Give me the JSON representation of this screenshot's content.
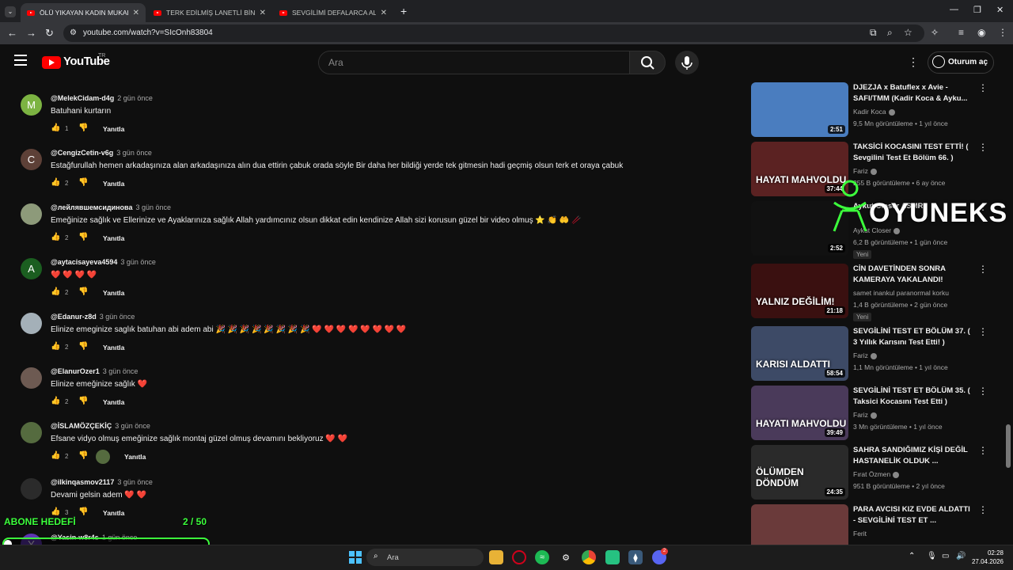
{
  "browser": {
    "tabs": [
      {
        "title": "ÖLÜ YIKAYAN KADIN MUKADDES",
        "active": true
      },
      {
        "title": "TERK EDİLMİŞ LANETLİ BİNAYA",
        "active": false
      },
      {
        "title": "SEVGİLİMİ DEFALARCA ALDATTI",
        "active": false
      }
    ],
    "new_tab": "+",
    "url": "youtube.com/watch?v=SIcOnh83804"
  },
  "header": {
    "logo_text": "YouTube",
    "region": "TR",
    "search_placeholder": "Ara",
    "signin_label": "Oturum aç"
  },
  "comments": [
    {
      "author": "@MelekCidam-d4g",
      "time": "2 gün önce",
      "text": "Batuhani kurtarın",
      "likes": "1",
      "reply": "Yanıtla",
      "avatar_letter": "M",
      "avatar_color": "#7cb342"
    },
    {
      "author": "@CengizCetin-v6g",
      "time": "3 gün önce",
      "text": "Estağfurullah hemen arkadaşınıza alan arkadaşınıza alın dua ettirin çabuk orada söyle Bir daha her bildiği yerde tek gitmesin hadi geçmiş olsun terk et oraya çabuk",
      "likes": "2",
      "reply": "Yanıtla",
      "avatar_letter": "C",
      "avatar_color": "#5d4037"
    },
    {
      "author": "@лейлявшемсидинова",
      "time": "3 gün önce",
      "text": "Emeğinize sağlık ve Ellerinize ve Ayaklarınıza sağlık Allah yardımcınız olsun dikkat edin kendinize Allah sizi korusun güzel bir video olmuş ⭐ 👏 🤲 🥢",
      "likes": "2",
      "reply": "Yanıtla",
      "avatar_letter": "",
      "avatar_color": "#8d9a7a"
    },
    {
      "author": "@aytacisayeva4594",
      "time": "3 gün önce",
      "text": "❤️ ❤️ ❤️ ❤️",
      "likes": "2",
      "reply": "Yanıtla",
      "avatar_letter": "A",
      "avatar_color": "#1b5e20"
    },
    {
      "author": "@Edanur-z8d",
      "time": "3 gün önce",
      "text": "Elinize emeginize saglık batuhan abi adem abi 🎉 🎉 🎉 🎉 🎉 🎉 🎉 🎉 ❤️ ❤️ ❤️ ❤️ ❤️ ❤️ ❤️ ❤️",
      "likes": "2",
      "reply": "Yanıtla",
      "avatar_letter": "",
      "avatar_color": "#a4b0b8"
    },
    {
      "author": "@ElanurOzer1",
      "time": "3 gün önce",
      "text": "Elinize emeğinize sağlık ❤️",
      "likes": "2",
      "reply": "Yanıtla",
      "avatar_letter": "",
      "avatar_color": "#6d5a52"
    },
    {
      "author": "@İSLAMÖZÇEKİÇ",
      "time": "3 gün önce",
      "text": "Efsane vidyo olmuş emeğinize sağlık montaj güzel olmuş devamını bekliyoruz ❤️ ❤️",
      "likes": "2",
      "reply": "Yanıtla",
      "avatar_letter": "",
      "avatar_color": "#556b3f"
    },
    {
      "author": "@ilkinqasmov2117",
      "time": "3 gün önce",
      "text": "Devami gelsin adem ❤️ ❤️",
      "likes": "3",
      "reply": "Yanıtla",
      "avatar_letter": "",
      "avatar_color": "#2b2b2b"
    },
    {
      "author": "@Yasin-w8r4s",
      "time": "1 gün önce",
      "text": "",
      "likes": "",
      "reply": "",
      "avatar_letter": "Y",
      "avatar_color": "#5e35b1"
    }
  ],
  "videos": [
    {
      "title": "DJEZJA x Batuflex x Avie - SAFI/TMM (Kadir Koca & Ayku...",
      "channel": "Kadir Koca",
      "meta": "9,5 Mn görüntüleme • 1 yıl önce",
      "duration": "2:51",
      "badge": "",
      "thumb_text": "",
      "thumb_color": "#4a7dbf"
    },
    {
      "title": "TAKSİCİ KOCASINI TEST ETTİ! ( Sevgilini Test Et Bölüm 66. )",
      "channel": "Fariz",
      "meta": "255 B görüntüleme • 6 ay önce",
      "duration": "37:44",
      "badge": "",
      "thumb_text": "HAYATI MAHVOLDU",
      "thumb_color": "#5b2222"
    },
    {
      "title": "Aykut Closer ASMR",
      "channel": "Aykut Closer",
      "meta": "6,2 B görüntüleme • 1 gün önce",
      "duration": "2:52",
      "badge": "Yeni",
      "thumb_text": "",
      "thumb_color": "#111111"
    },
    {
      "title": "CİN DAVETİNDEN SONRA KAMERAYA YAKALANDI!",
      "channel": "samet inankul paranormal korku",
      "meta": "1,4 B görüntüleme • 2 gün önce",
      "duration": "21:18",
      "badge": "Yeni",
      "thumb_text": "YALNIZ DEĞİLİM!",
      "thumb_color": "#3a1010"
    },
    {
      "title": "SEVGİLİNİ TEST ET BÖLÜM 37. ( 3 Yıllık Karısını Test Etti! )",
      "channel": "Fariz",
      "meta": "1,1 Mn görüntüleme • 1 yıl önce",
      "duration": "58:54",
      "badge": "",
      "thumb_text": "KARISI ALDATTI",
      "thumb_color": "#3d4a66"
    },
    {
      "title": "SEVGİLİNİ TEST ET BÖLÜM 35. ( Taksici Kocasını Test Etti )",
      "channel": "Fariz",
      "meta": "3 Mn görüntüleme • 1 yıl önce",
      "duration": "39:49",
      "badge": "",
      "thumb_text": "HAYATI MAHVOLDU",
      "thumb_color": "#4a3a5a"
    },
    {
      "title": "SAHRA SANDIĞIMIZ KİŞİ DEĞİL HASTANELİK OLDUK ...",
      "channel": "Fırat Özmen",
      "meta": "951 B görüntüleme • 2 yıl önce",
      "duration": "24:35",
      "badge": "",
      "thumb_text": "ÖLÜMDEN DÖNDÜM",
      "thumb_color": "#2a2a2a"
    },
    {
      "title": "PARA AVCISI KIZ EVDE ALDATTI - SEVGİLİNİ TEST ET ...",
      "channel": "Ferit",
      "meta": "",
      "duration": "",
      "badge": "",
      "thumb_text": "",
      "thumb_color": "#6a3a3a"
    }
  ],
  "overlay": {
    "watermark": "OYUNEKS",
    "goal_label": "ABONE HEDEFİ",
    "goal_count": "2 / 50",
    "goal_progress": 0.04
  },
  "taskbar": {
    "search_label": "Ara",
    "time": "02:28",
    "date": "27.04.2026",
    "discord_badge": "2"
  },
  "colors": {
    "accent": "#ff0000",
    "goal_green": "#3cff3c"
  }
}
